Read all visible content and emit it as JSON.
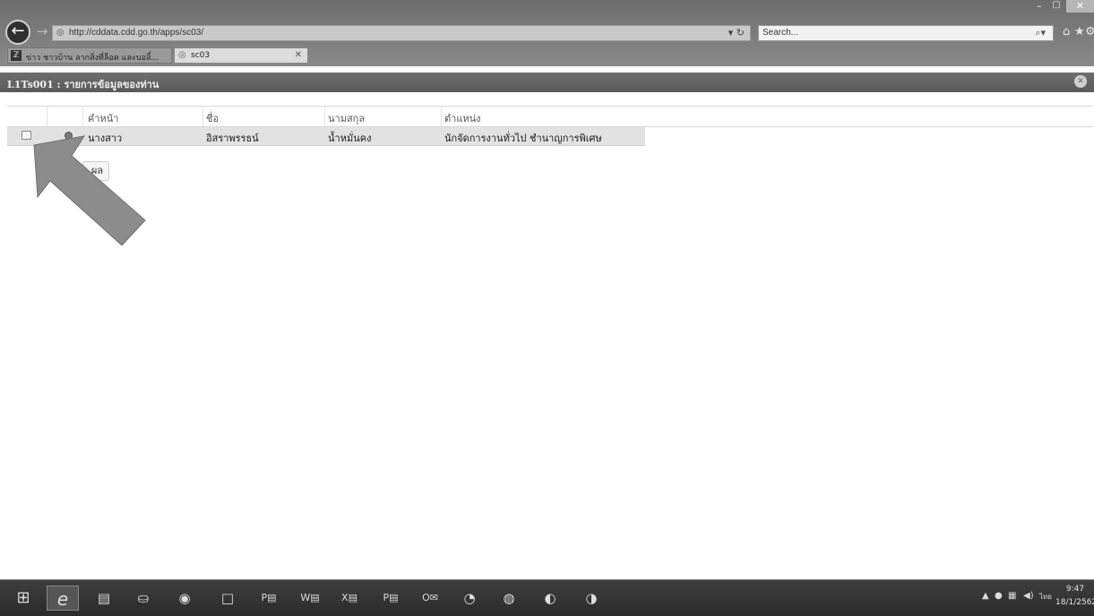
{
  "browser": {
    "url": "http://cddata.cdd.go.th/apps/sc03/",
    "address_controls": "▾ ↻",
    "search_placeholder": "Search...",
    "tabs": [
      {
        "label": "ข่าว ชาวบ้าน ลากสิ่งที่ล็อค และบอลิ์..."
      },
      {
        "label": "sc03"
      }
    ]
  },
  "app": {
    "title": "L1Ts001 : รายการข้อมูลของท่าน"
  },
  "grid": {
    "headers": [
      "คำหน้า",
      "ชื่อ",
      "นามสกุล",
      "ตำแหน่ง"
    ],
    "rows": [
      {
        "prefix": "นางสาว",
        "first_name": "อิสราพรรธน์",
        "last_name": "น้ำหมั่นคง",
        "position": "นักจัดการงานทั่วไป ชำนาญการพิเศษ"
      }
    ]
  },
  "partial_button_label": "ผล",
  "taskbar": {
    "apps": [
      "start-icon",
      "ie-icon",
      "file-explorer-icon",
      "store-icon",
      "chrome-icon",
      "window-icon",
      "powerpoint-icon",
      "word-icon",
      "excel-icon",
      "publisher-icon",
      "outlook-icon",
      "camera-icon",
      "line-icon",
      "messenger-icon",
      "app-icon"
    ],
    "lang": "ไทย",
    "time": "9:47",
    "date": "18/1/2562"
  },
  "colors": {
    "chrome": "#7a7a7a",
    "appbar": "#636363",
    "row_bg": "#e2e2e2",
    "arrow": "#8a8a8a"
  }
}
